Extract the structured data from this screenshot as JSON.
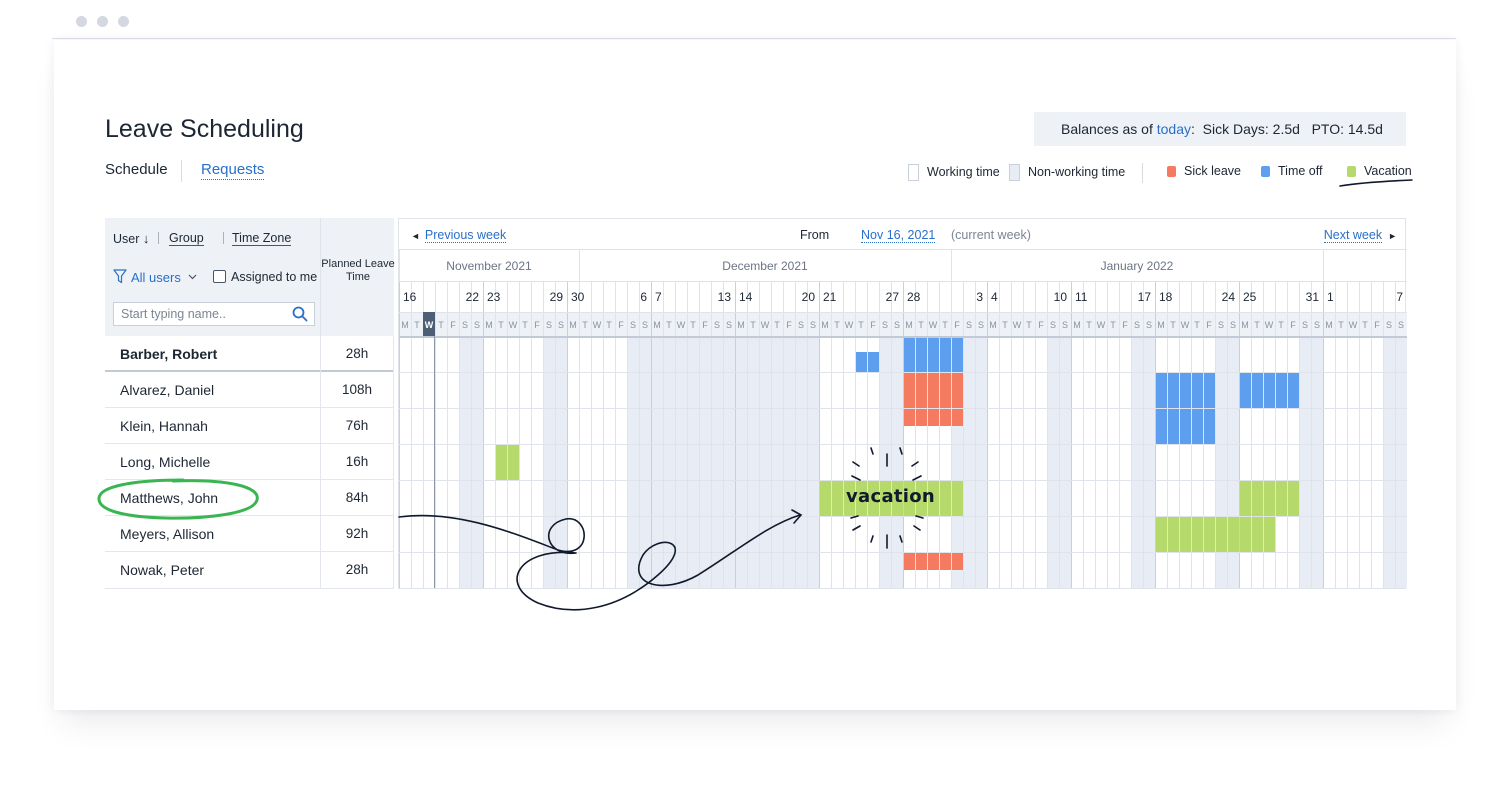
{
  "page": {
    "title": "Leave Scheduling",
    "tabs": [
      {
        "label": "Schedule",
        "active": true
      },
      {
        "label": "Requests",
        "active": false
      }
    ],
    "balances": {
      "prefix": "Balances as of ",
      "link": "today",
      "rest": ":  Sick Days: 2.5d   PTO: 14.5d"
    }
  },
  "legend": [
    {
      "label": "Working time",
      "color": "#ffffff",
      "kind": "outline"
    },
    {
      "label": "Non-working time",
      "color": "#e8edf5",
      "kind": "outline"
    },
    {
      "label": "Sick leave",
      "color": "#f47b5f",
      "kind": "fill"
    },
    {
      "label": "Time off",
      "color": "#5e9eef",
      "kind": "fill"
    },
    {
      "label": "Vacation",
      "color": "#b5d96a",
      "kind": "fill"
    }
  ],
  "filters": {
    "user": "User",
    "group": "Group",
    "time_zone": "Time Zone",
    "all_users": "All users",
    "assigned_to_me": "Assigned to me",
    "search_placeholder": "Start typing name..",
    "planned_header": "Planned Leave Time"
  },
  "users": [
    {
      "name": "Barber, Robert",
      "hours": "28h"
    },
    {
      "name": "Alvarez, Daniel",
      "hours": "108h"
    },
    {
      "name": "Klein, Hannah",
      "hours": "76h"
    },
    {
      "name": "Long, Michelle",
      "hours": "16h"
    },
    {
      "name": "Matthews, John",
      "hours": "84h"
    },
    {
      "name": "Meyers, Allison",
      "hours": "92h"
    },
    {
      "name": "Nowak, Peter",
      "hours": "28h"
    }
  ],
  "calendar_nav": {
    "previous": "Previous week",
    "from_label": "From",
    "from_date": "Nov 16, 2021",
    "current": "(current week)",
    "next": "Next week"
  },
  "months": [
    "November 2021",
    "December 2021",
    "January 2022"
  ],
  "week_labels": [
    [
      "16",
      "22"
    ],
    [
      "23",
      "29"
    ],
    [
      "30",
      "6"
    ],
    [
      "7",
      "13"
    ],
    [
      "14",
      "20"
    ],
    [
      "21",
      "27"
    ],
    [
      "28",
      "3"
    ],
    [
      "4",
      "10"
    ],
    [
      "11",
      "17"
    ],
    [
      "18",
      "24"
    ],
    [
      "25",
      "31"
    ],
    [
      "1",
      "7"
    ]
  ],
  "weekday_letters": [
    "M",
    "T",
    "W",
    "T",
    "F",
    "S",
    "S"
  ],
  "today_index": 2,
  "leave_blocks": [
    {
      "row": 0,
      "type": "timeoff",
      "days": [
        38,
        39
      ]
    },
    {
      "row": 0,
      "type": "timeoff",
      "days": [
        42,
        43,
        44
      ]
    },
    {
      "row": 0,
      "type": "timeoff",
      "days": [
        45,
        46
      ]
    },
    {
      "row": 1,
      "type": "sick",
      "days": [
        42,
        43,
        44,
        45,
        46
      ]
    },
    {
      "row": 1,
      "type": "timeoff",
      "days": [
        63,
        64,
        65,
        66,
        67
      ]
    },
    {
      "row": 1,
      "type": "timeoff",
      "days": [
        70,
        71,
        72,
        73,
        74
      ]
    },
    {
      "row": 2,
      "type": "sick",
      "days": [
        42,
        43,
        44,
        45,
        46
      ]
    },
    {
      "row": 2,
      "type": "timeoff",
      "days": [
        63,
        64,
        65,
        66,
        67
      ]
    },
    {
      "row": 3,
      "type": "vacation",
      "days": [
        8,
        9
      ]
    },
    {
      "row": 4,
      "type": "vacation",
      "days": [
        35,
        36,
        37,
        38,
        39,
        40,
        41,
        42,
        43,
        44,
        45,
        46
      ]
    },
    {
      "row": 4,
      "type": "vacation",
      "days": [
        70,
        71,
        72,
        73,
        74
      ]
    },
    {
      "row": 5,
      "type": "vacation",
      "days": [
        63,
        64,
        65,
        66,
        67,
        68,
        69,
        70,
        71,
        72
      ]
    },
    {
      "row": 6,
      "type": "sick",
      "days": [
        42,
        43,
        44,
        45,
        46
      ]
    }
  ],
  "annotation": {
    "word": "vacation"
  }
}
